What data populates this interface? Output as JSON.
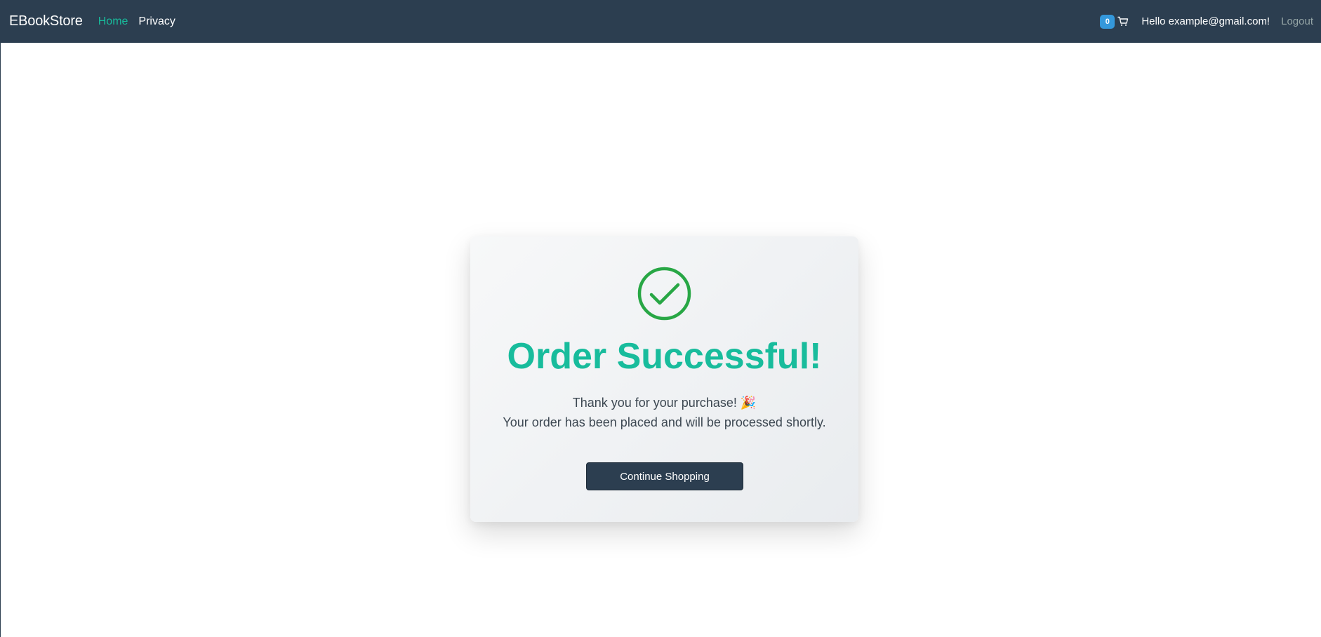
{
  "navbar": {
    "brand": "EBookStore",
    "links": [
      {
        "label": "Home"
      },
      {
        "label": "Privacy"
      }
    ],
    "cart_count": "0",
    "greeting": "Hello example@gmail.com!",
    "logout": "Logout"
  },
  "order": {
    "icon": "check-circle-icon",
    "title": "Order Successful!",
    "message_line1": "Thank you for your purchase! 🎉",
    "message_line2": "Your order has been placed and will be processed shortly.",
    "button_label": "Continue Shopping"
  },
  "colors": {
    "navbar_bg": "#2c3e50",
    "accent": "#18bc9c",
    "success_icon": "#28a745",
    "badge": "#3498db",
    "button_bg": "#2c3e50"
  }
}
